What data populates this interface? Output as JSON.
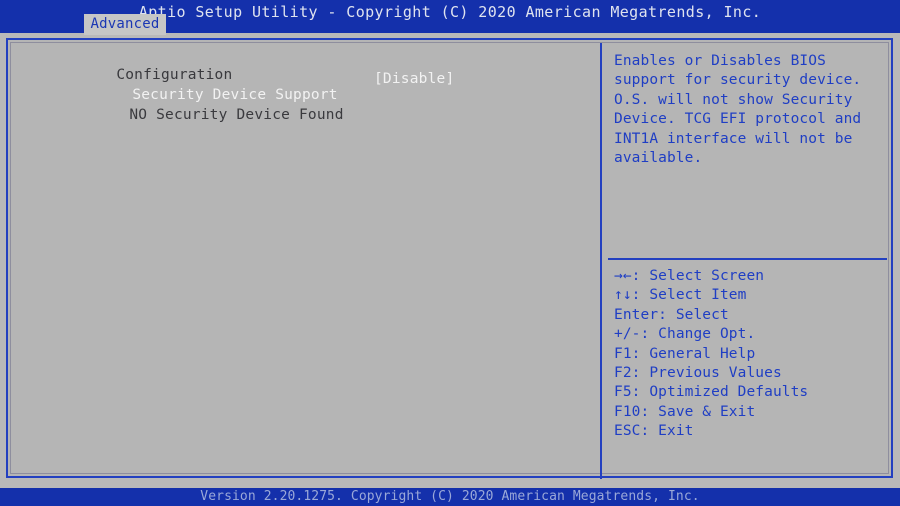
{
  "header": {
    "title": "Aptio Setup Utility - Copyright (C) 2020 American Megatrends, Inc.",
    "active_tab": "Advanced",
    "tabs": [
      "Advanced"
    ]
  },
  "main": {
    "group_title": "Configuration",
    "settings": [
      {
        "label": "Security Device Support",
        "value": "[Disable]",
        "selected": true
      }
    ],
    "status_text": "NO Security Device Found"
  },
  "help": {
    "lines": [
      "Enables or Disables BIOS",
      "support for security device.",
      "O.S. will not show Security",
      "Device. TCG EFI protocol and",
      "INT1A interface will not be",
      "available."
    ]
  },
  "legend": {
    "items": [
      {
        "key": "→←",
        "action": ": Select Screen"
      },
      {
        "key": "↑↓",
        "action": ": Select Item"
      },
      {
        "key": "Enter",
        "action": ": Select"
      },
      {
        "key": "+/-",
        "action": ": Change Opt."
      },
      {
        "key": "F1",
        "action": ": General Help"
      },
      {
        "key": "F2",
        "action": ": Previous Values"
      },
      {
        "key": "F5",
        "action": ": Optimized Defaults"
      },
      {
        "key": "F10",
        "action": ": Save & Exit"
      },
      {
        "key": "ESC",
        "action": ": Exit"
      }
    ]
  },
  "footer": {
    "version_text": "Version 2.20.1275. Copyright (C) 2020 American Megatrends, Inc."
  },
  "colors": {
    "header_blue": "#1430ab",
    "panel_gray": "#b5b5b5",
    "border_blue": "#2340c0",
    "help_text_blue": "#1f3ec4",
    "selected_text": "#f2f2f2",
    "normal_text": "#39393d"
  }
}
